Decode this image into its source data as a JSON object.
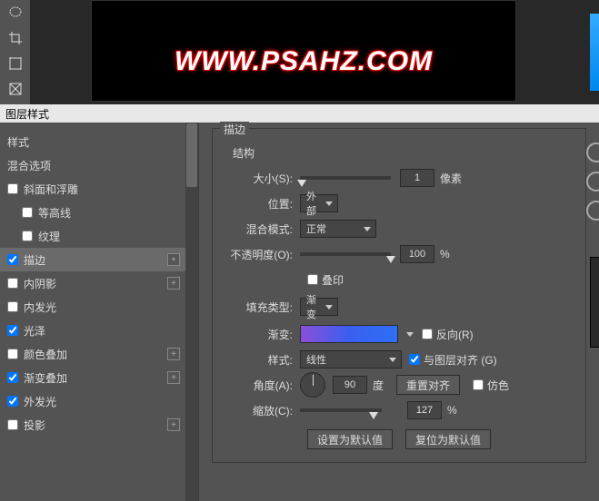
{
  "canvas": {
    "text": "WWW.PSAHZ.COM"
  },
  "dialog": {
    "title": "图层样式"
  },
  "leftPanel": {
    "items": [
      {
        "label": "样式"
      },
      {
        "label": "混合选项"
      },
      {
        "label": "斜面和浮雕"
      },
      {
        "label": "等高线"
      },
      {
        "label": "纹理"
      },
      {
        "label": "描边"
      },
      {
        "label": "内阴影"
      },
      {
        "label": "内发光"
      },
      {
        "label": "光泽"
      },
      {
        "label": "颜色叠加"
      },
      {
        "label": "渐变叠加"
      },
      {
        "label": "外发光"
      },
      {
        "label": "投影"
      }
    ]
  },
  "stroke": {
    "groupTitle": "描边",
    "structureLabel": "结构",
    "sizeLabel": "大小(S):",
    "sizeValue": "1",
    "sizeUnit": "像素",
    "positionLabel": "位置:",
    "positionValue": "外部",
    "blendLabel": "混合模式:",
    "blendValue": "正常",
    "opacityLabel": "不透明度(O):",
    "opacityValue": "100",
    "opacityUnit": "%",
    "overprintLabel": "叠印",
    "fillTypeLabel": "填充类型:",
    "fillTypeValue": "渐变",
    "gradientLabel": "渐变:",
    "reverseLabel": "反向(R)",
    "styleLabel": "样式:",
    "styleValue": "线性",
    "alignLabel": "与图层对齐 (G)",
    "angleLabel": "角度(A):",
    "angleValue": "90",
    "angleUnit": "度",
    "resetAlignLabel": "重置对齐",
    "ditherLabel": "仿色",
    "scaleLabel": "缩放(C):",
    "scaleValue": "127",
    "scaleUnit": "%",
    "setDefaultLabel": "设置为默认值",
    "resetDefaultLabel": "复位为默认值"
  }
}
